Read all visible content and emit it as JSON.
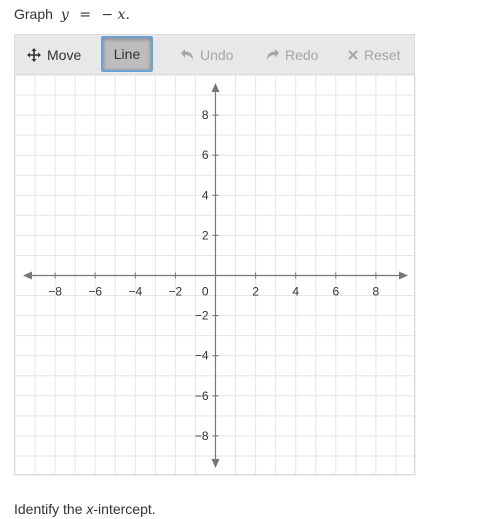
{
  "prompt": {
    "lead": "Graph",
    "eq_lhs": "y",
    "eq_op": "=",
    "eq_rhs": "− x",
    "eq_end": "."
  },
  "toolbar": {
    "move_label": "Move",
    "line_label": "Line",
    "undo_label": "Undo",
    "redo_label": "Redo",
    "reset_label": "Reset",
    "selected_tool": "Line",
    "move_icon": "move-arrows-icon",
    "undo_icon": "undo-arrow-icon",
    "redo_icon": "redo-arrow-icon",
    "reset_icon": "close-x-icon"
  },
  "graph": {
    "x_range": [
      -10,
      10
    ],
    "y_range": [
      -10,
      10
    ],
    "grid_step": 1,
    "label_step": 2,
    "x_labels": [
      "−8",
      "−6",
      "−4",
      "−2",
      "2",
      "4",
      "6",
      "8"
    ],
    "y_labels": [
      "8",
      "6",
      "4",
      "2",
      "−2",
      "−4",
      "−6",
      "−8"
    ],
    "origin_label": "0",
    "grid_color": "#e6e6e6",
    "axis_color": "#777777"
  },
  "question": {
    "before": "Identify the ",
    "var": "x",
    "after": "-intercept."
  }
}
